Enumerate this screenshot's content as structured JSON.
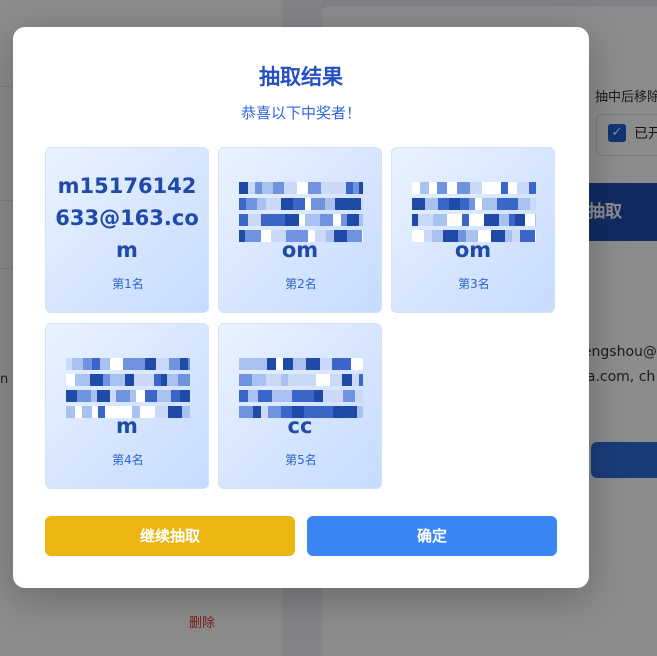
{
  "background": {
    "after_draw_label": "抽中后移除",
    "checkbox_label": "已开",
    "draw_button_label": "抽取",
    "email_line_1": "fengshou@",
    "email_line_2": "na.com, ch",
    "delete_label": "删除",
    "left_letter": "n"
  },
  "modal": {
    "title": "抽取结果",
    "subtitle": "恭喜以下中奖者！",
    "winners": [
      {
        "name": "m15176142633@163.com",
        "rank": "第1名",
        "masked": false
      },
      {
        "name": "om",
        "rank": "第2名",
        "masked": true
      },
      {
        "name": "om",
        "rank": "第3名",
        "masked": true
      },
      {
        "name": "m",
        "rank": "第4名",
        "masked": true
      },
      {
        "name": "cc",
        "rank": "第5名",
        "masked": true
      }
    ],
    "continue_label": "继续抽取",
    "confirm_label": "确定"
  },
  "colors": {
    "title": "#2550c4",
    "card_text": "#1f4aa8",
    "continue_button": "#ecb511",
    "confirm_button": "#3b84f3"
  }
}
